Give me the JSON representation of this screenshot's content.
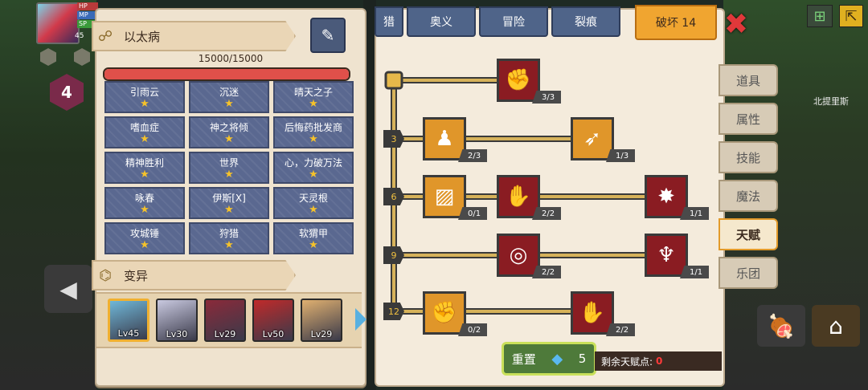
{
  "hud": {
    "level": "45",
    "hp_label": "HP",
    "stat_a": "MP",
    "stat_b": "SP",
    "badge_level": "4"
  },
  "disease_panel": {
    "title": "以太病",
    "hp_text": "15000/15000",
    "hp_fraction": 1.0,
    "traits": [
      {
        "name": "引雨云",
        "stars": "★"
      },
      {
        "name": "沉迷",
        "stars": "★"
      },
      {
        "name": "晴天之子",
        "stars": "★"
      },
      {
        "name": "嗜血症",
        "stars": "★"
      },
      {
        "name": "神之将倾",
        "stars": "★"
      },
      {
        "name": "后悔药批发商",
        "stars": "★"
      },
      {
        "name": "精神胜利",
        "stars": "★"
      },
      {
        "name": "世界",
        "stars": "★"
      },
      {
        "name": "心，力破万法",
        "stars": "★"
      },
      {
        "name": "咏春",
        "stars": "★"
      },
      {
        "name": "伊斯[X]",
        "stars": "★"
      },
      {
        "name": "天灵根",
        "stars": "★"
      },
      {
        "name": "攻城锤",
        "stars": "★"
      },
      {
        "name": "狩猎",
        "stars": "★"
      },
      {
        "name": "软猬甲",
        "stars": "★"
      }
    ],
    "mutation_title": "变异"
  },
  "heroes": [
    {
      "lv": "Lv45",
      "color": "#6fb7d8"
    },
    {
      "lv": "Lv30",
      "color": "#c9c9e0"
    },
    {
      "lv": "Lv29",
      "color": "#8a2a3a"
    },
    {
      "lv": "Lv50",
      "color": "#c02a2a"
    },
    {
      "lv": "Lv29",
      "color": "#e0b070"
    }
  ],
  "tabs": {
    "t0": "猎",
    "t1": "奥义",
    "t2": "冒险",
    "t3": "裂痕",
    "active": "破坏 14"
  },
  "talent_tree": {
    "levels": [
      "3",
      "6",
      "9",
      "12"
    ],
    "nodes": [
      {
        "icon": "arm-wrestle-icon",
        "glyph": "✊",
        "count": "3/3"
      },
      {
        "icon": "body-icon",
        "glyph": "♟",
        "count": "2/3"
      },
      {
        "icon": "crack-arrow-icon",
        "glyph": "➶",
        "count": "1/3"
      },
      {
        "icon": "card-icon",
        "glyph": "▨",
        "count": "0/1"
      },
      {
        "icon": "punch-icon",
        "glyph": "✋",
        "count": "2/2"
      },
      {
        "icon": "blast-icon",
        "glyph": "✸",
        "count": "1/1"
      },
      {
        "icon": "ripple-icon",
        "glyph": "◎",
        "count": "2/2"
      },
      {
        "icon": "demon-icon",
        "glyph": "♆",
        "count": "1/1"
      },
      {
        "icon": "fist-icon",
        "glyph": "✊",
        "count": "0/2"
      },
      {
        "icon": "bound-fist-icon",
        "glyph": "✋",
        "count": "2/2"
      }
    ]
  },
  "reset": {
    "label": "重置",
    "cost": "5",
    "remaining_label": "剩余天赋点:",
    "remaining_value": "0"
  },
  "side_menu": [
    "道具",
    "属性",
    "技能",
    "魔法",
    "天赋",
    "乐团"
  ],
  "map": {
    "label": "北提里斯"
  }
}
